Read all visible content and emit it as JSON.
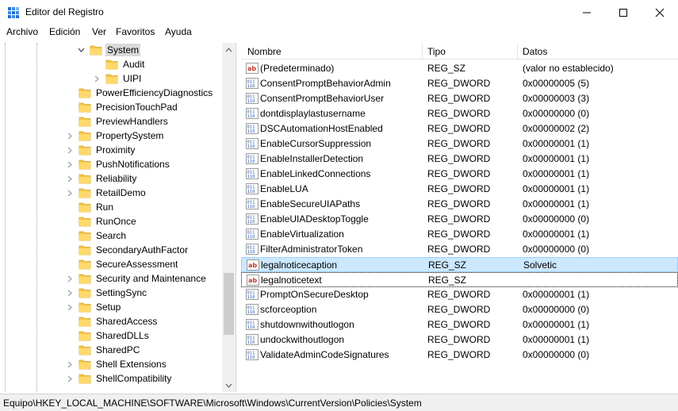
{
  "window": {
    "title": "Editor del Registro",
    "minimize_icon": "minimize-icon",
    "maximize_icon": "maximize-icon",
    "close_icon": "close-icon"
  },
  "menu": [
    {
      "label": "Archivo"
    },
    {
      "label": "Edición"
    },
    {
      "label": "Ver"
    },
    {
      "label": "Favoritos"
    },
    {
      "label": "Ayuda"
    }
  ],
  "tree": {
    "selected": "System",
    "items": [
      {
        "label": "System",
        "expanded": true,
        "level": 1
      },
      {
        "label": "Audit",
        "level": 2
      },
      {
        "label": "UIPI",
        "level": 2,
        "has_children": true
      },
      {
        "label": "PowerEfficiencyDiagnostics",
        "level": 0
      },
      {
        "label": "PrecisionTouchPad",
        "level": 0
      },
      {
        "label": "PreviewHandlers",
        "level": 0
      },
      {
        "label": "PropertySystem",
        "level": 0,
        "has_children": true
      },
      {
        "label": "Proximity",
        "level": 0,
        "has_children": true
      },
      {
        "label": "PushNotifications",
        "level": 0,
        "has_children": true
      },
      {
        "label": "Reliability",
        "level": 0,
        "has_children": true
      },
      {
        "label": "RetailDemo",
        "level": 0,
        "has_children": true
      },
      {
        "label": "Run",
        "level": 0
      },
      {
        "label": "RunOnce",
        "level": 0
      },
      {
        "label": "Search",
        "level": 0
      },
      {
        "label": "SecondaryAuthFactor",
        "level": 0
      },
      {
        "label": "SecureAssessment",
        "level": 0
      },
      {
        "label": "Security and Maintenance",
        "level": 0,
        "has_children": true
      },
      {
        "label": "SettingSync",
        "level": 0,
        "has_children": true
      },
      {
        "label": "Setup",
        "level": 0,
        "has_children": true
      },
      {
        "label": "SharedAccess",
        "level": 0
      },
      {
        "label": "SharedDLLs",
        "level": 0
      },
      {
        "label": "SharedPC",
        "level": 0
      },
      {
        "label": "Shell Extensions",
        "level": 0,
        "has_children": true
      },
      {
        "label": "ShellCompatibility",
        "level": 0,
        "has_children": true
      }
    ]
  },
  "list": {
    "columns": [
      "Nombre",
      "Tipo",
      "Datos"
    ],
    "rows": [
      {
        "name": "(Predeterminado)",
        "type": "REG_SZ",
        "data": "(valor no establecido)",
        "icon": "string-value-icon"
      },
      {
        "name": "ConsentPromptBehaviorAdmin",
        "type": "REG_DWORD",
        "data": "0x00000005 (5)",
        "icon": "binary-value-icon"
      },
      {
        "name": "ConsentPromptBehaviorUser",
        "type": "REG_DWORD",
        "data": "0x00000003 (3)",
        "icon": "binary-value-icon"
      },
      {
        "name": "dontdisplaylastusername",
        "type": "REG_DWORD",
        "data": "0x00000000 (0)",
        "icon": "binary-value-icon"
      },
      {
        "name": "DSCAutomationHostEnabled",
        "type": "REG_DWORD",
        "data": "0x00000002 (2)",
        "icon": "binary-value-icon"
      },
      {
        "name": "EnableCursorSuppression",
        "type": "REG_DWORD",
        "data": "0x00000001 (1)",
        "icon": "binary-value-icon"
      },
      {
        "name": "EnableInstallerDetection",
        "type": "REG_DWORD",
        "data": "0x00000001 (1)",
        "icon": "binary-value-icon"
      },
      {
        "name": "EnableLinkedConnections",
        "type": "REG_DWORD",
        "data": "0x00000001 (1)",
        "icon": "binary-value-icon"
      },
      {
        "name": "EnableLUA",
        "type": "REG_DWORD",
        "data": "0x00000001 (1)",
        "icon": "binary-value-icon"
      },
      {
        "name": "EnableSecureUIAPaths",
        "type": "REG_DWORD",
        "data": "0x00000001 (1)",
        "icon": "binary-value-icon"
      },
      {
        "name": "EnableUIADesktopToggle",
        "type": "REG_DWORD",
        "data": "0x00000000 (0)",
        "icon": "binary-value-icon"
      },
      {
        "name": "EnableVirtualization",
        "type": "REG_DWORD",
        "data": "0x00000001 (1)",
        "icon": "binary-value-icon"
      },
      {
        "name": "FilterAdministratorToken",
        "type": "REG_DWORD",
        "data": "0x00000000 (0)",
        "icon": "binary-value-icon"
      },
      {
        "name": "legalnoticecaption",
        "type": "REG_SZ",
        "data": "Solvetic",
        "icon": "string-value-icon",
        "selected": true
      },
      {
        "name": "legalnoticetext",
        "type": "REG_SZ",
        "data": "",
        "icon": "string-value-icon",
        "focused": true
      },
      {
        "name": "PromptOnSecureDesktop",
        "type": "REG_DWORD",
        "data": "0x00000001 (1)",
        "icon": "binary-value-icon"
      },
      {
        "name": "scforceoption",
        "type": "REG_DWORD",
        "data": "0x00000000 (0)",
        "icon": "binary-value-icon"
      },
      {
        "name": "shutdownwithoutlogon",
        "type": "REG_DWORD",
        "data": "0x00000001 (1)",
        "icon": "binary-value-icon"
      },
      {
        "name": "undockwithoutlogon",
        "type": "REG_DWORD",
        "data": "0x00000001 (1)",
        "icon": "binary-value-icon"
      },
      {
        "name": "ValidateAdminCodeSignatures",
        "type": "REG_DWORD",
        "data": "0x00000000 (0)",
        "icon": "binary-value-icon"
      }
    ]
  },
  "status": {
    "path": "Equipo\\HKEY_LOCAL_MACHINE\\SOFTWARE\\Microsoft\\Windows\\CurrentVersion\\Policies\\System"
  },
  "colors": {
    "selection": "#cce8ff",
    "folder": "#f3c551",
    "string_icon": "#c0392b",
    "binary_icon": "#2d5fb3"
  }
}
